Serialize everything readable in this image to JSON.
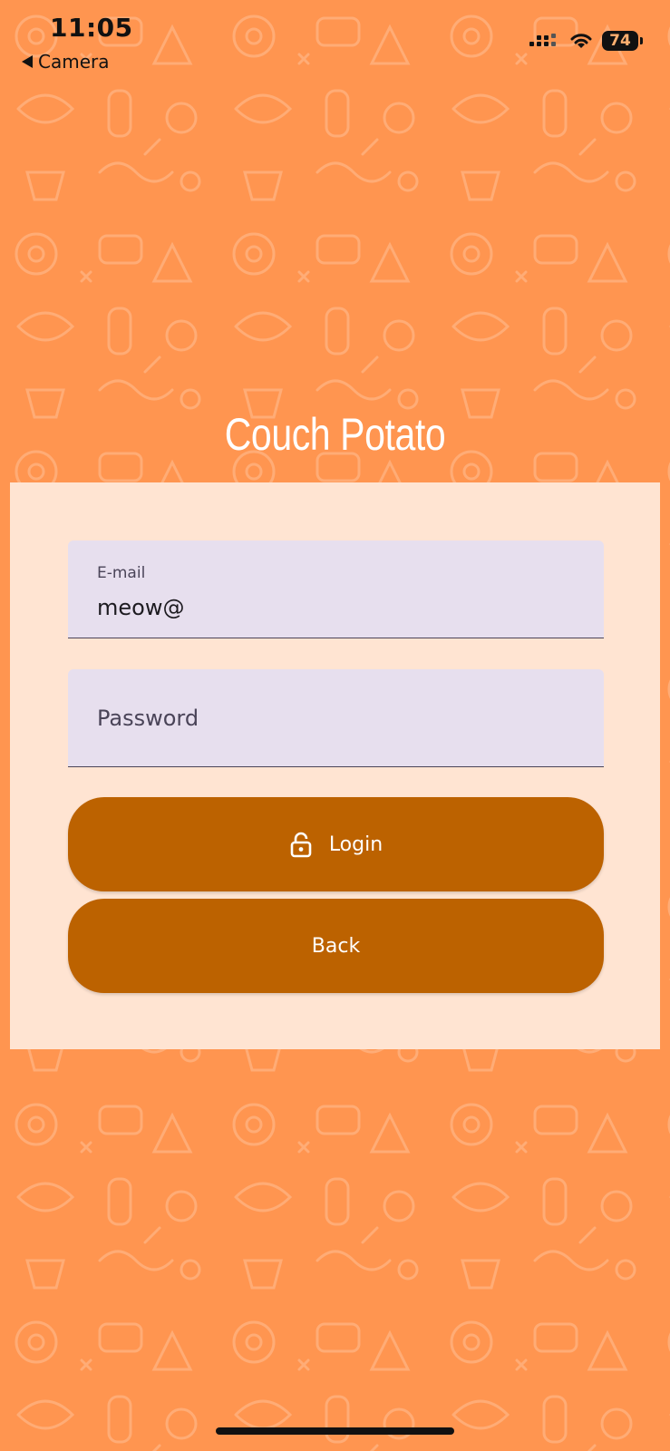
{
  "status_bar": {
    "time": "11:05",
    "back_label": "Camera",
    "battery": "74",
    "icons": [
      "signal-icon",
      "wifi-icon",
      "battery-icon"
    ]
  },
  "app": {
    "title": "Couch Potato"
  },
  "form": {
    "email": {
      "label": "E-mail",
      "value": "meow@"
    },
    "password": {
      "placeholder": "Password",
      "value": ""
    }
  },
  "buttons": {
    "login_label": "Login",
    "login_icon": "lock-icon",
    "back_label": "Back"
  },
  "colors": {
    "background": "#FF9550",
    "card": "#FFE4D2",
    "field": "#E7DFEE",
    "button": "#BC6200",
    "title_text": "#FFFFFF"
  }
}
